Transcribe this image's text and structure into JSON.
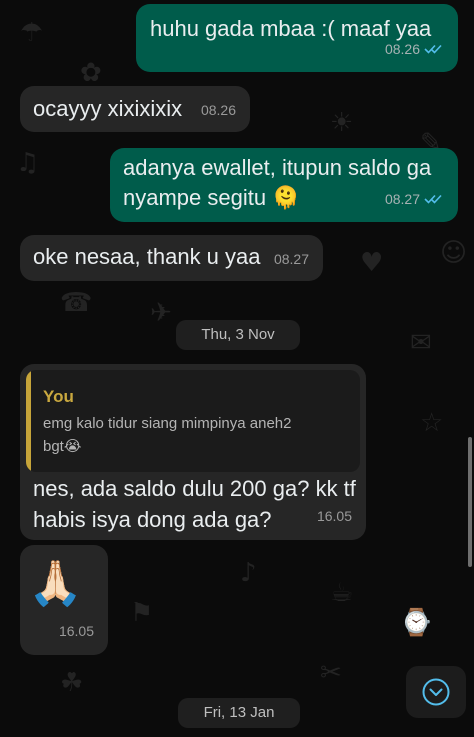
{
  "messages": [
    {
      "direction": "outgoing",
      "text": "huhu gada mbaa :( maaf yaa",
      "time": "08.26",
      "status": "read"
    },
    {
      "direction": "incoming",
      "text": "ocayyy xixixixix",
      "time": "08.26"
    },
    {
      "direction": "outgoing",
      "line1": "adanya ewallet, itupun saldo ga",
      "line2": "nyampe segitu",
      "emoji": "🫠",
      "time": "08.27",
      "status": "read"
    },
    {
      "direction": "incoming",
      "text": "oke nesaa, thank u yaa",
      "time": "08.27"
    },
    {
      "direction": "incoming",
      "reply_to": {
        "author": "You",
        "line1": "emg kalo tidur siang mimpinya aneh2",
        "line2": "bgt",
        "emoji": "😭"
      },
      "line1": "nes, ada saldo dulu 200 ga? kk tf",
      "line2": "habis isya dong ada ga?",
      "time": "16.05"
    },
    {
      "direction": "incoming",
      "emoji": "🙏🏻",
      "time": "16.05"
    }
  ],
  "date_separators": [
    "Thu, 3 Nov",
    "Fri, 13 Jan"
  ],
  "icons": {
    "read_receipt": "double-check-icon",
    "scroll_down": "chevron-down-circle-icon"
  },
  "colors": {
    "outgoing_bubble": "#005c4b",
    "incoming_bubble": "#262626",
    "read_ticks": "#53bdeb",
    "quote_accent": "#c9a83f"
  }
}
